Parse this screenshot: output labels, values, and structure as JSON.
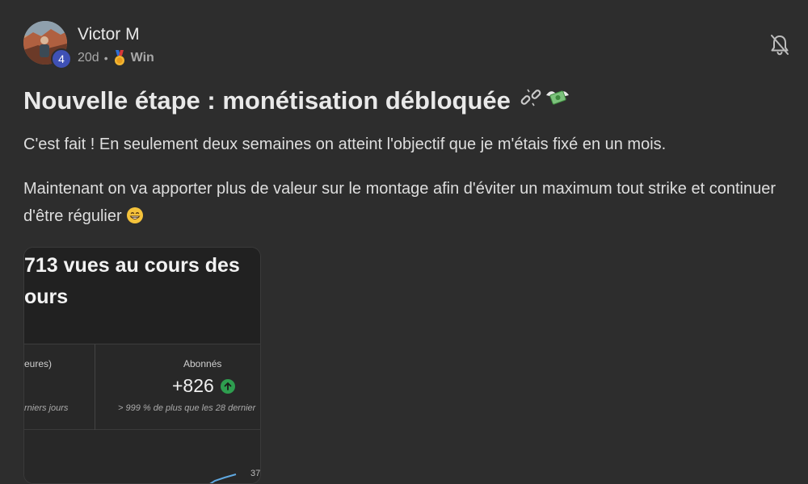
{
  "author": {
    "name": "Victor M",
    "level": "4",
    "age": "20d",
    "separator": "•",
    "category_icon": "medal-icon",
    "category": "Win"
  },
  "actions": {
    "notifications_icon": "bell-off-icon"
  },
  "post": {
    "title": "Nouvelle étape : monétisation débloquée",
    "title_icons": [
      "broken-chain-icon",
      "flying-money-icon"
    ],
    "paragraph_1": "C'est fait ! En seulement deux semaines on atteint l'objectif que je m'étais fixé en un mois.",
    "paragraph_2": "Maintenant on va apporter plus de valeur sur le montage afin d'éviter un maximum tout strike et continuer d'être régulier",
    "paragraph_2_emoji": "grinning-face-icon"
  },
  "attachment": {
    "heading_line_1": "713 vues au cours des",
    "heading_line_2": "ours",
    "left_stat_label": "eures)",
    "left_stat_sub": "rniers jours",
    "stat_label": "Abonnés",
    "stat_value": "+826",
    "stat_trend_icon": "arrow-up-icon",
    "stat_sub": "> 999 % de plus que les 28 dernier",
    "graph_tick": "37"
  },
  "colors": {
    "background": "#2d2d2d",
    "level_badge": "#3f51b5",
    "trend_up": "#2e9e4f"
  }
}
